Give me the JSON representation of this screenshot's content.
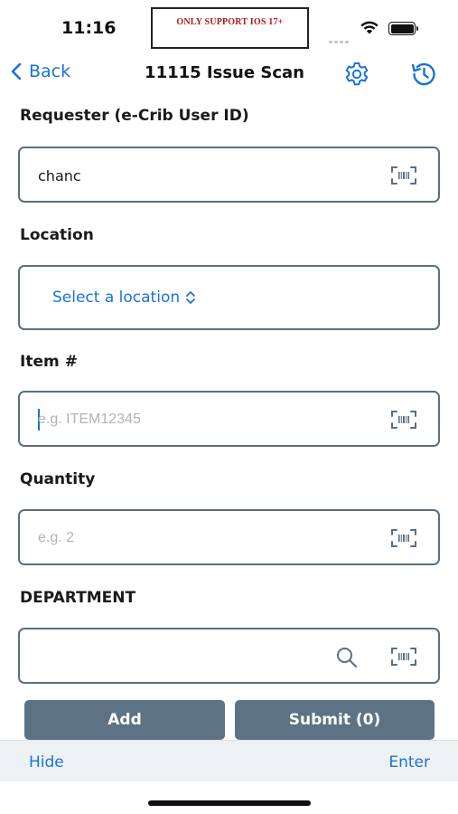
{
  "status_bar": {
    "time": "11:16",
    "banner_text": "ONLY SUPPORT IOS 17+"
  },
  "nav": {
    "back_label": "Back",
    "title": "11115 Issue Scan",
    "gear_icon": "gear-icon",
    "history_icon": "history-icon"
  },
  "form": {
    "requester": {
      "label": "Requester (e-Crib User ID)",
      "value": "chanc"
    },
    "location": {
      "label": "Location",
      "select_label": "Select a location"
    },
    "item": {
      "label": "Item #",
      "placeholder": "e.g. ITEM12345"
    },
    "quantity": {
      "label": "Quantity",
      "placeholder": "e.g. 2"
    },
    "department": {
      "label": "DEPARTMENT"
    }
  },
  "buttons": {
    "add": "Add",
    "submit": "Submit (0)"
  },
  "accessory": {
    "hide": "Hide",
    "enter": "Enter"
  },
  "colors": {
    "accent": "#1a73d6",
    "button": "#5d7385",
    "field_border": "#5a6f80",
    "banner_text": "#b0161d"
  }
}
